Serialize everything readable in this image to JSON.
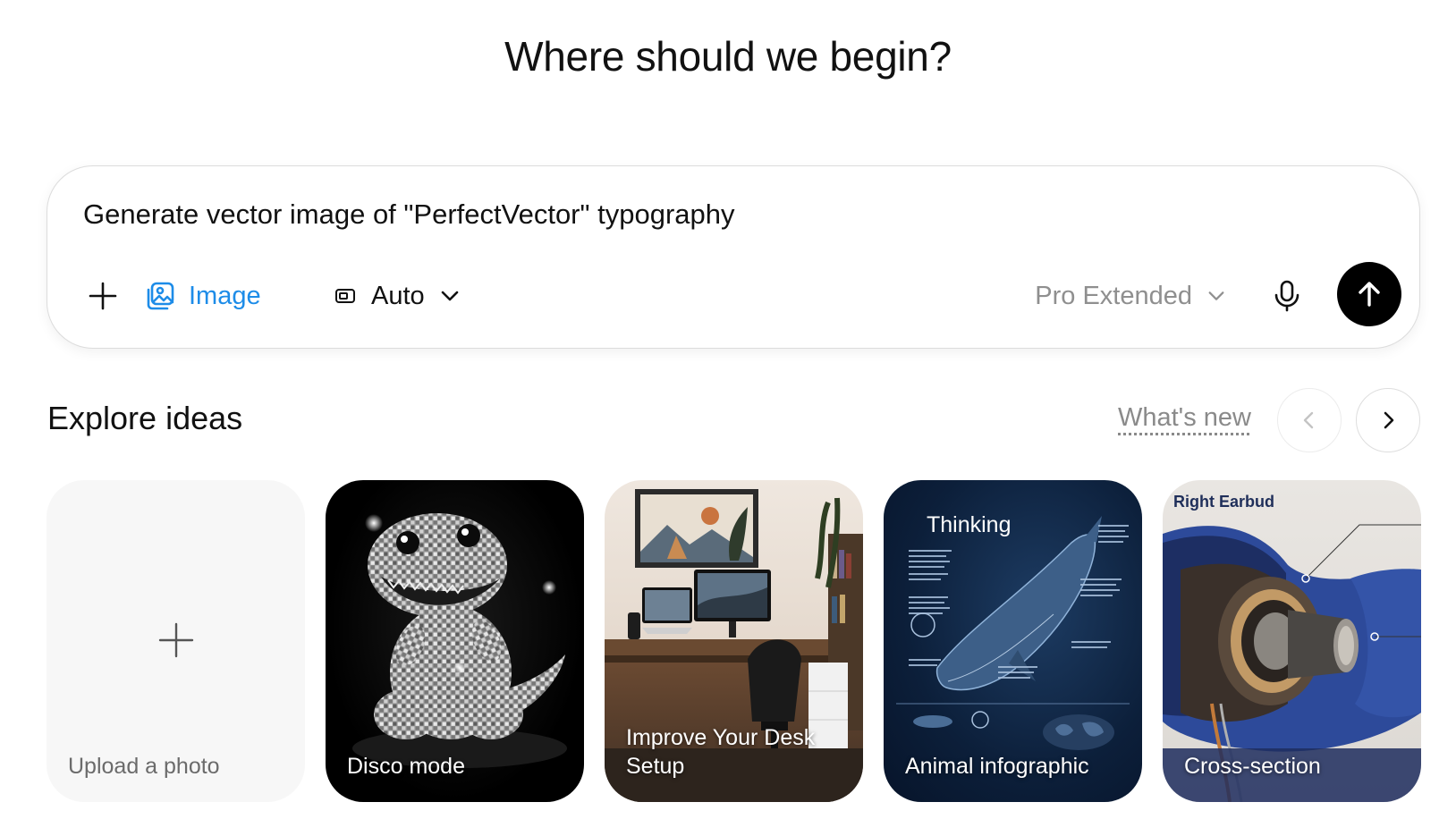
{
  "headline": "Where should we begin?",
  "composer": {
    "prompt": "Generate vector image of \"PerfectVector\" typography",
    "image_label": "Image",
    "aspect_label": "Auto",
    "model_label": "Pro Extended"
  },
  "explore": {
    "title": "Explore ideas",
    "whats_new": "What's new",
    "cards": [
      {
        "label": "Upload a photo"
      },
      {
        "label": "Disco mode"
      },
      {
        "label": "Improve Your Desk Setup"
      },
      {
        "label": "Animal infographic",
        "tag": "Thinking"
      },
      {
        "label": "Cross-section",
        "tag": "Right Earbud"
      }
    ]
  },
  "colors": {
    "accent": "#1d8ce8",
    "send_button": "#000000"
  },
  "icons": [
    "plus-icon",
    "image-icon",
    "aspect-ratio-icon",
    "chevron-down-icon",
    "microphone-icon",
    "arrow-up-icon",
    "chevron-left-icon",
    "chevron-right-icon"
  ]
}
